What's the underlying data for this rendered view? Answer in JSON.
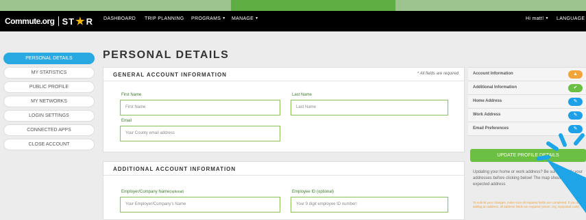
{
  "header": {
    "logo": {
      "commute": "Commute.org",
      "star_left": "ST",
      "star_right": "R"
    },
    "nav": {
      "dashboard": "DASHBOARD",
      "trip_planning": "TRIP PLANNING",
      "programs": "PROGRAMS",
      "manage": "MANAGE",
      "user": "Hi matt!",
      "language": "LANGUAGE"
    }
  },
  "sidebar": {
    "items": [
      {
        "label": "PERSONAL DETAILS",
        "active": true
      },
      {
        "label": "MY STATISTICS"
      },
      {
        "label": "PUBLIC PROFILE"
      },
      {
        "label": "MY NETWORKS"
      },
      {
        "label": "LOGIN SETTINGS"
      },
      {
        "label": "CONNECTED APPS"
      },
      {
        "label": "CLOSE ACCOUNT"
      }
    ]
  },
  "page": {
    "title": "PERSONAL DETAILS"
  },
  "general": {
    "title": "GENERAL ACCOUNT INFORMATION",
    "required_note": "* All fields are required",
    "first_name": {
      "label": "First Name",
      "placeholder": "First Name"
    },
    "last_name": {
      "label": "Last Name",
      "placeholder": "Last Name"
    },
    "email": {
      "label": "Email",
      "placeholder": "Your County email address"
    }
  },
  "additional": {
    "title": "ADDITIONAL ACCOUNT INFORMATION",
    "employer": {
      "label": "Employer/Company Name",
      "optional": "(optional)",
      "placeholder": "Your Employer/Company's Name"
    },
    "employee_id": {
      "label": "Employee ID",
      "optional": "(optional)",
      "placeholder": "Your 9 digit employee ID number!"
    }
  },
  "summary": {
    "rows": [
      {
        "label": "Account Information",
        "status": "warning",
        "icon": "warning-icon"
      },
      {
        "label": "Additional Information",
        "status": "complete",
        "icon": "check-icon"
      },
      {
        "label": "Home Address",
        "status": "edit",
        "icon": "edit-icon"
      },
      {
        "label": "Work Address",
        "status": "edit",
        "icon": "edit-icon"
      },
      {
        "label": "Email Preferences",
        "status": "edit",
        "icon": "edit-icon"
      }
    ],
    "update_button": "UPDATE PROFILE DETAILS",
    "help": "Updating your home or work address? Be sure to verify your addresses before clicking below! The map should match your expected address",
    "warning": "To submit your changes, make sure all required fields are completed. If you are adding an address, all address fields are required (street, city, zip/postal code)"
  },
  "colors": {
    "brand_green": "#6bbf43",
    "field_border": "#8bbf5e",
    "active_blue": "#29a9e1",
    "warning_orange": "#f0a43a",
    "edit_blue": "#1ea0e8"
  }
}
